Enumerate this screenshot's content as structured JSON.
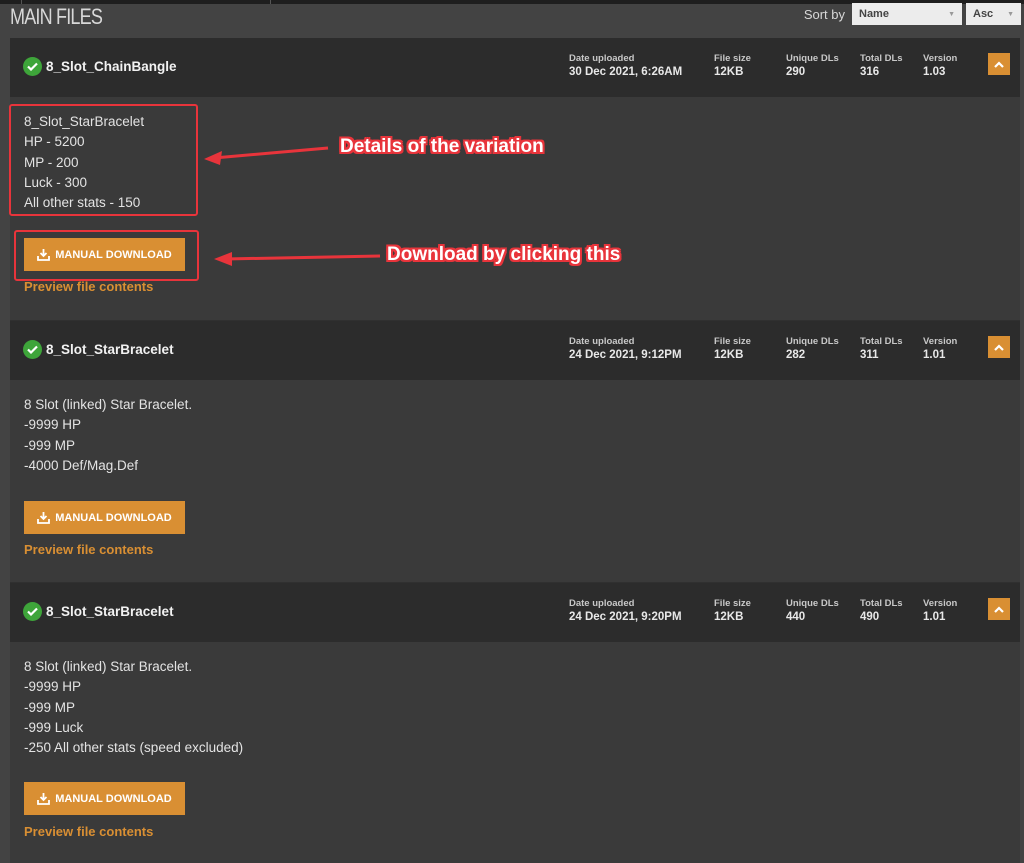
{
  "section": {
    "title": "MAIN FILES",
    "sort_label": "Sort by",
    "sort_field": "Name",
    "sort_order": "Asc"
  },
  "stat_labels": {
    "date": "Date uploaded",
    "size": "File size",
    "unique": "Unique DLs",
    "total": "Total DLs",
    "version": "Version"
  },
  "files": [
    {
      "name": "8_Slot_ChainBangle",
      "date": "30 Dec 2021, 6:26AM",
      "size": "12KB",
      "unique": "290",
      "total": "316",
      "version": "1.03",
      "description": [
        "8_Slot_StarBracelet",
        "HP - 5200",
        "MP - 200",
        "Luck - 300",
        "All other stats - 150"
      ],
      "download_label": "MANUAL DOWNLOAD",
      "preview_label": "Preview file contents"
    },
    {
      "name": "8_Slot_StarBracelet",
      "date": "24 Dec 2021, 9:12PM",
      "size": "12KB",
      "unique": "282",
      "total": "311",
      "version": "1.01",
      "description": [
        "8 Slot (linked) Star Bracelet.",
        "-9999 HP",
        "-999 MP",
        "-4000 Def/Mag.Def"
      ],
      "download_label": "MANUAL DOWNLOAD",
      "preview_label": "Preview file contents"
    },
    {
      "name": "8_Slot_StarBracelet",
      "date": "24 Dec 2021, 9:20PM",
      "size": "12KB",
      "unique": "440",
      "total": "490",
      "version": "1.01",
      "description": [
        "8 Slot (linked) Star Bracelet.",
        "-9999 HP",
        "-999 MP",
        "-999 Luck",
        "-250 All other stats (speed excluded)"
      ],
      "download_label": "MANUAL DOWNLOAD",
      "preview_label": "Preview file contents"
    }
  ],
  "annotations": {
    "details": "Details of the variation",
    "download": "Download by clicking this"
  },
  "colors": {
    "accent": "#d98f33",
    "verified": "#3ea53a",
    "annotation": "#e8343b"
  }
}
